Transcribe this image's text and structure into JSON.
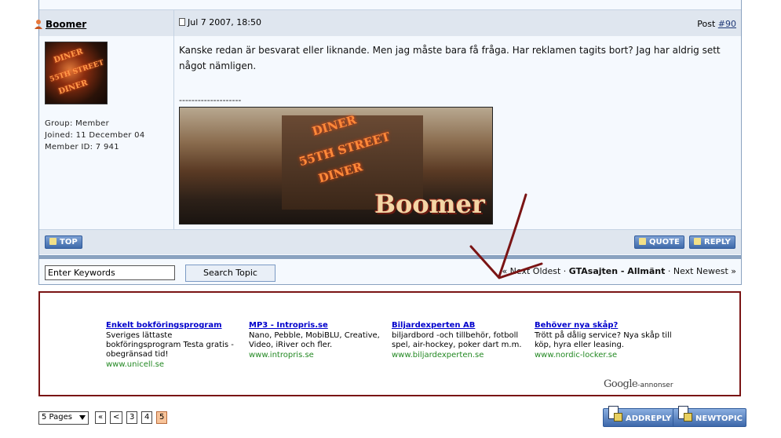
{
  "post": {
    "username": "Boomer",
    "date": "Jul 7 2007, 18:50",
    "post_label": "Post",
    "post_number": "#90",
    "user_info": {
      "group": "Group: Member",
      "joined": "Joined: 11 December 04",
      "member_id": "Member ID: 7 941"
    },
    "body": "Kanske redan är besvarat eller liknande. Men jag måste bara få fråga. Har reklamen tagits bort? Jag har aldrig sett något nämligen.",
    "signature_separator": "--------------------",
    "signature_image_text": "Boomer",
    "avatar_text": [
      "DINER",
      "55TH STREET",
      "DINER"
    ],
    "buttons": {
      "top": "TOP",
      "quote": "QUOTE",
      "reply": "REPLY"
    }
  },
  "search": {
    "input_value": "Enter Keywords",
    "button_label": "Search Topic"
  },
  "topic_nav": {
    "prev": "« Next Oldest",
    "sep1": "·",
    "forum": "GTAsajten - Allmänt",
    "sep2": "·",
    "next": "Next Newest »"
  },
  "ads": [
    {
      "title": "Enkelt bokföringsprogram",
      "text": "Sveriges lättaste bokföringsprogram Testa gratis - obegränsad tid!",
      "url": "www.unicell.se"
    },
    {
      "title": "MP3 - Intropris.se",
      "text": "Nano, Pebble, MobiBLU, Creative, Video, iRiver och fler.",
      "url": "www.intropris.se"
    },
    {
      "title": "Biljardexperten AB",
      "text": "biljardbord -och tillbehör, fotboll spel, air-hockey, poker dart m.m.",
      "url": "www.biljardexperten.se"
    },
    {
      "title": "Behöver nya skåp?",
      "text": "Trött på dålig service? Nya skåp till köp, hyra eller leasing.",
      "url": "www.nordic-locker.se"
    }
  ],
  "google": {
    "logo": "Google",
    "suffix": "-annonser"
  },
  "pagination": {
    "select_label": "5 Pages",
    "first": "«",
    "prev": "<",
    "pages": [
      "3",
      "4",
      "5"
    ],
    "current": "5"
  },
  "bottom_buttons": {
    "add_reply": "ADDREPLY",
    "new_topic": "NEWTOPIC"
  },
  "colors": {
    "ad_border": "#7a1414",
    "arrow": "#7a1414",
    "header_bg": "#dfe6ef",
    "ad_link": "#0000cc",
    "ad_url": "#228822"
  }
}
